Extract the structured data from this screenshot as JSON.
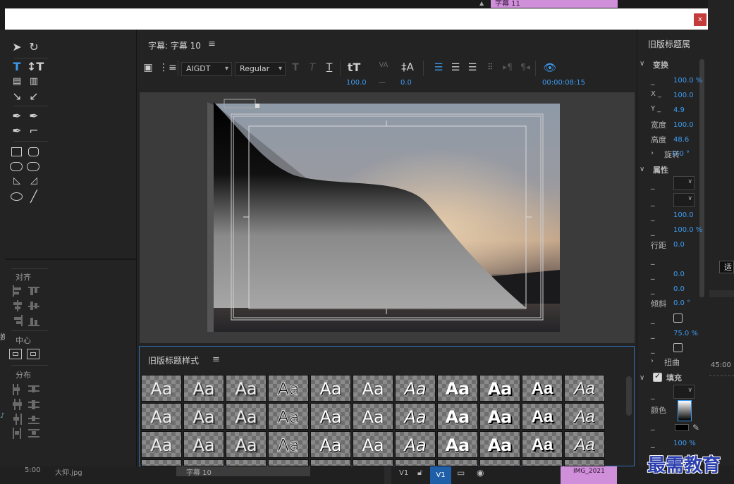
{
  "background": {
    "top_clip_label": "字幕 11",
    "right_edge_labels": [
      "适",
      "45:00"
    ],
    "left_edge_label": "媒",
    "bottom": {
      "left_time": "5:00",
      "left_file": "大仰.jpg",
      "clip_label": "字幕 10",
      "track_v1_a": "V1",
      "track_v1_b": "V1",
      "clip_img": "IMG_2021"
    }
  },
  "dialog": {
    "close_label": "x"
  },
  "tools": {
    "align_label": "对齐",
    "center_label": "中心",
    "distribute_label": "分布"
  },
  "title_panel": {
    "title": "字幕: 字幕 10",
    "menu": "≡",
    "font_family": "AIGDT",
    "font_style": "Regular",
    "font_size": "100.0",
    "kerning": "—",
    "leading": "0.0",
    "timecode": "00:00:08:15"
  },
  "styles_panel": {
    "title": "旧版标题样式",
    "menu": "≡",
    "swatch_text": "Aa",
    "rows": 4,
    "cols": 11
  },
  "properties": {
    "title": "旧版标题属",
    "transform_label": "变换",
    "opacity_value": "100.0 %",
    "x_label": "X _",
    "x_value": "100.0",
    "y_label": "Y _",
    "y_value": "4.9",
    "width_label": "宽度",
    "width_value": "100.0",
    "height_label": "高度",
    "height_value": "48.6",
    "rotation_label": "旋转",
    "rotation_value": "0.0 °",
    "attributes_label": "属性",
    "font_size_value": "100.0",
    "aspect_value": "100.0 %",
    "leading_label": "行距",
    "leading_value": "0.0",
    "kerning_value": "0.0",
    "tracking_value": "0.0",
    "slant_label": "倾斜",
    "slant_value": "0.0 °",
    "baseline_value": "75.0 %",
    "distort_label": "扭曲",
    "fill_label": "填充",
    "color_label": "颜色",
    "fill_opacity_value": "100 %",
    "dash": "_"
  },
  "watermark": "最需教育",
  "colors": {
    "accent_blue": "#3d9bf0",
    "close_red": "#c43b3b",
    "clip_pink": "#cf8fd9",
    "styles_border": "#2f6fb3"
  }
}
